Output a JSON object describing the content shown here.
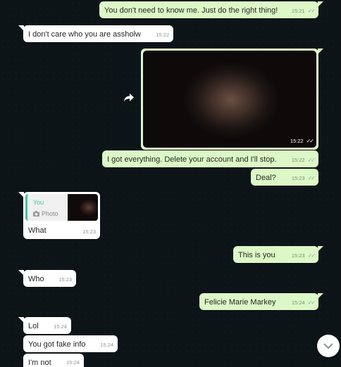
{
  "messages": [
    {
      "text": "You don't need to know me. Just do the right thing!",
      "time": "15:21",
      "ticks": "✓✓"
    },
    {
      "text": "I don't care who you are assholw",
      "time": "15:22"
    },
    {
      "time": "15:22",
      "ticks": "✓✓"
    },
    {
      "text": "I got everything. Delete your account and I'll stop.",
      "time": "15:22",
      "ticks": "✓✓"
    },
    {
      "text": "Deal?",
      "time": "15:23",
      "ticks": "✓✓"
    },
    {
      "text": "What",
      "time": "15:23",
      "quote": {
        "author": "You",
        "kind": "Photo"
      }
    },
    {
      "text": "This is you",
      "time": "15:23",
      "ticks": "✓✓"
    },
    {
      "text": "Who",
      "time": "15:23"
    },
    {
      "text": "Felicie Marie Markey",
      "time": "15:24",
      "ticks": "✓✓"
    },
    {
      "text": "Lol",
      "time": "15:24"
    },
    {
      "text": "You got fake info",
      "time": "15:24"
    },
    {
      "text": "I'm not",
      "time": "15:24"
    }
  ],
  "icons": {
    "forward": "forward-icon",
    "camera": "camera-icon",
    "scroll_down": "chevron-down-icon"
  },
  "colors": {
    "background": "#0d1418",
    "outgoing": "#dcf8c6",
    "incoming": "#ffffff",
    "quote_accent": "#35cd96"
  }
}
